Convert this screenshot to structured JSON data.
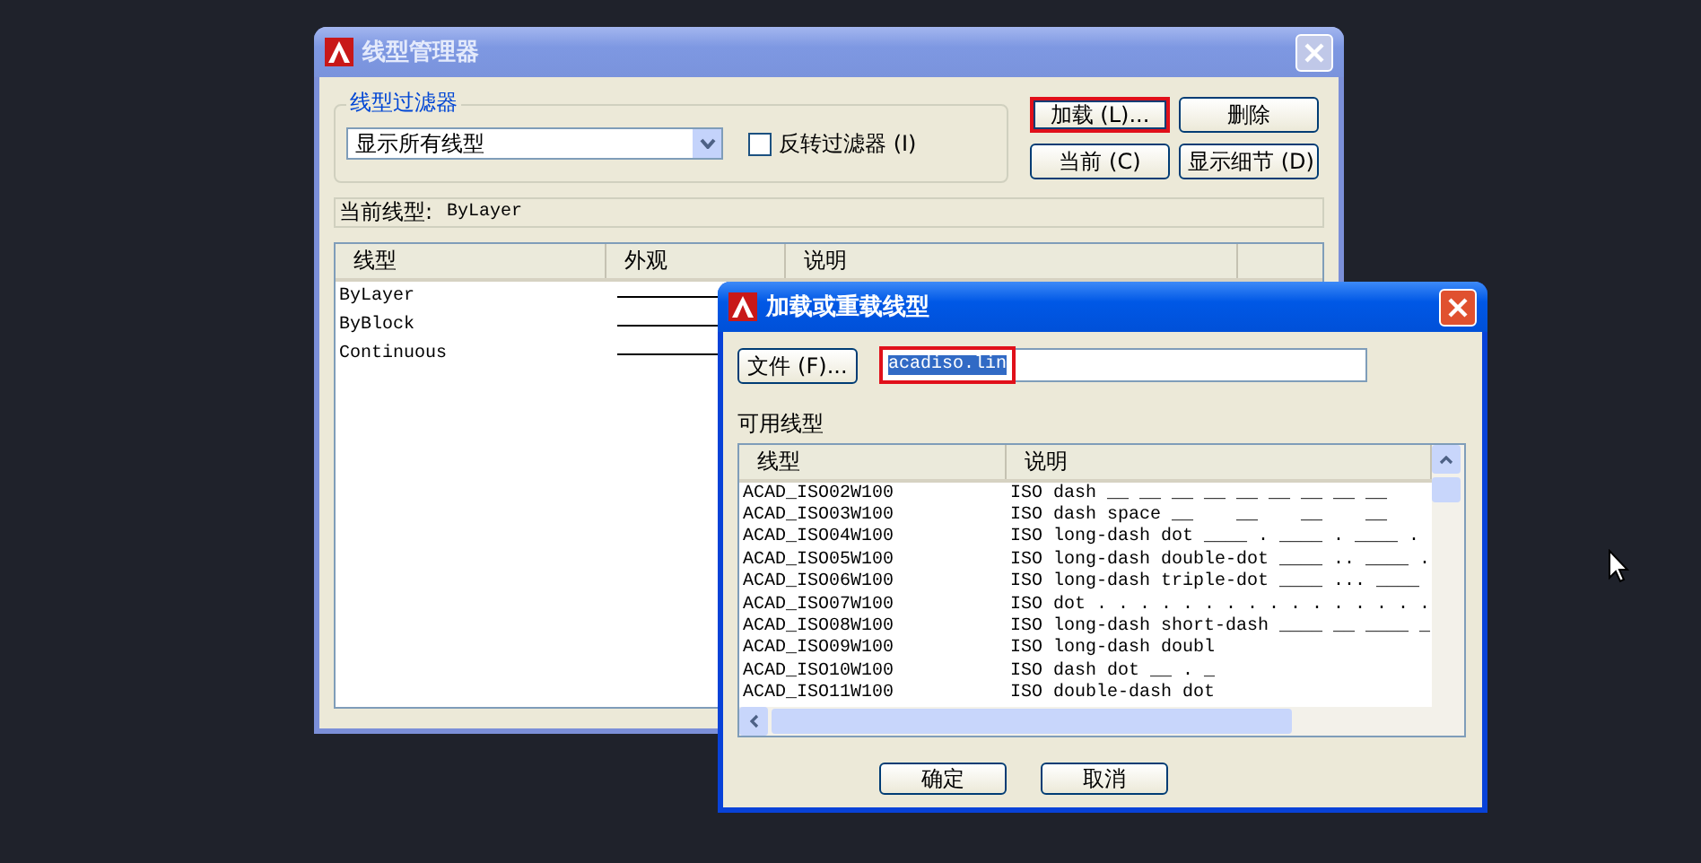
{
  "linetype_manager": {
    "title": "线型管理器",
    "active": false,
    "filter": {
      "group_label": "线型过滤器",
      "dropdown_value": "显示所有线型",
      "invert_label": "反转过滤器 (I)",
      "invert_checked": false
    },
    "buttons": [
      {
        "label": "加载 (L)...",
        "highlighted": true
      },
      {
        "label": "删除",
        "highlighted": false
      },
      {
        "label": "当前 (C)",
        "highlighted": false
      },
      {
        "label": "显示细节 (D)",
        "highlighted": false
      }
    ],
    "current_label": "当前线型:",
    "current_value": "ByLayer",
    "columns": [
      "线型",
      "外观",
      "说明"
    ],
    "rows": [
      {
        "name": "ByLayer"
      },
      {
        "name": "ByBlock"
      },
      {
        "name": "Continuous"
      }
    ]
  },
  "load_dialog": {
    "title": "加载或重载线型",
    "active": true,
    "file_button": "文件 (F)...",
    "file_value": "acadiso.lin",
    "file_highlighted": true,
    "list_label": "可用线型",
    "columns": [
      "线型",
      "说明"
    ],
    "rows": [
      {
        "name": "ACAD_ISO02W100",
        "description": "ISO dash __ __ __ __ __ __ __ __ __"
      },
      {
        "name": "ACAD_ISO03W100",
        "description": "ISO dash space __    __    __    __"
      },
      {
        "name": "ACAD_ISO04W100",
        "description": "ISO long-dash dot ____ . ____ . ____ ."
      },
      {
        "name": "ACAD_ISO05W100",
        "description": "ISO long-dash double-dot ____ .. ____ ."
      },
      {
        "name": "ACAD_ISO06W100",
        "description": "ISO long-dash triple-dot ____ ... ____"
      },
      {
        "name": "ACAD_ISO07W100",
        "description": "ISO dot . . . . . . . . . . . . . . . ."
      },
      {
        "name": "ACAD_ISO08W100",
        "description": "ISO long-dash short-dash ____ __ ____ _"
      },
      {
        "name": "ACAD_ISO09W100",
        "description": "ISO long-dash doubl"
      },
      {
        "name": "ACAD_ISO10W100",
        "description": "ISO dash dot __ . _"
      },
      {
        "name": "ACAD_ISO11W100",
        "description": "ISO double-dash dot"
      }
    ],
    "buttons": [
      "确定",
      "取消"
    ]
  }
}
